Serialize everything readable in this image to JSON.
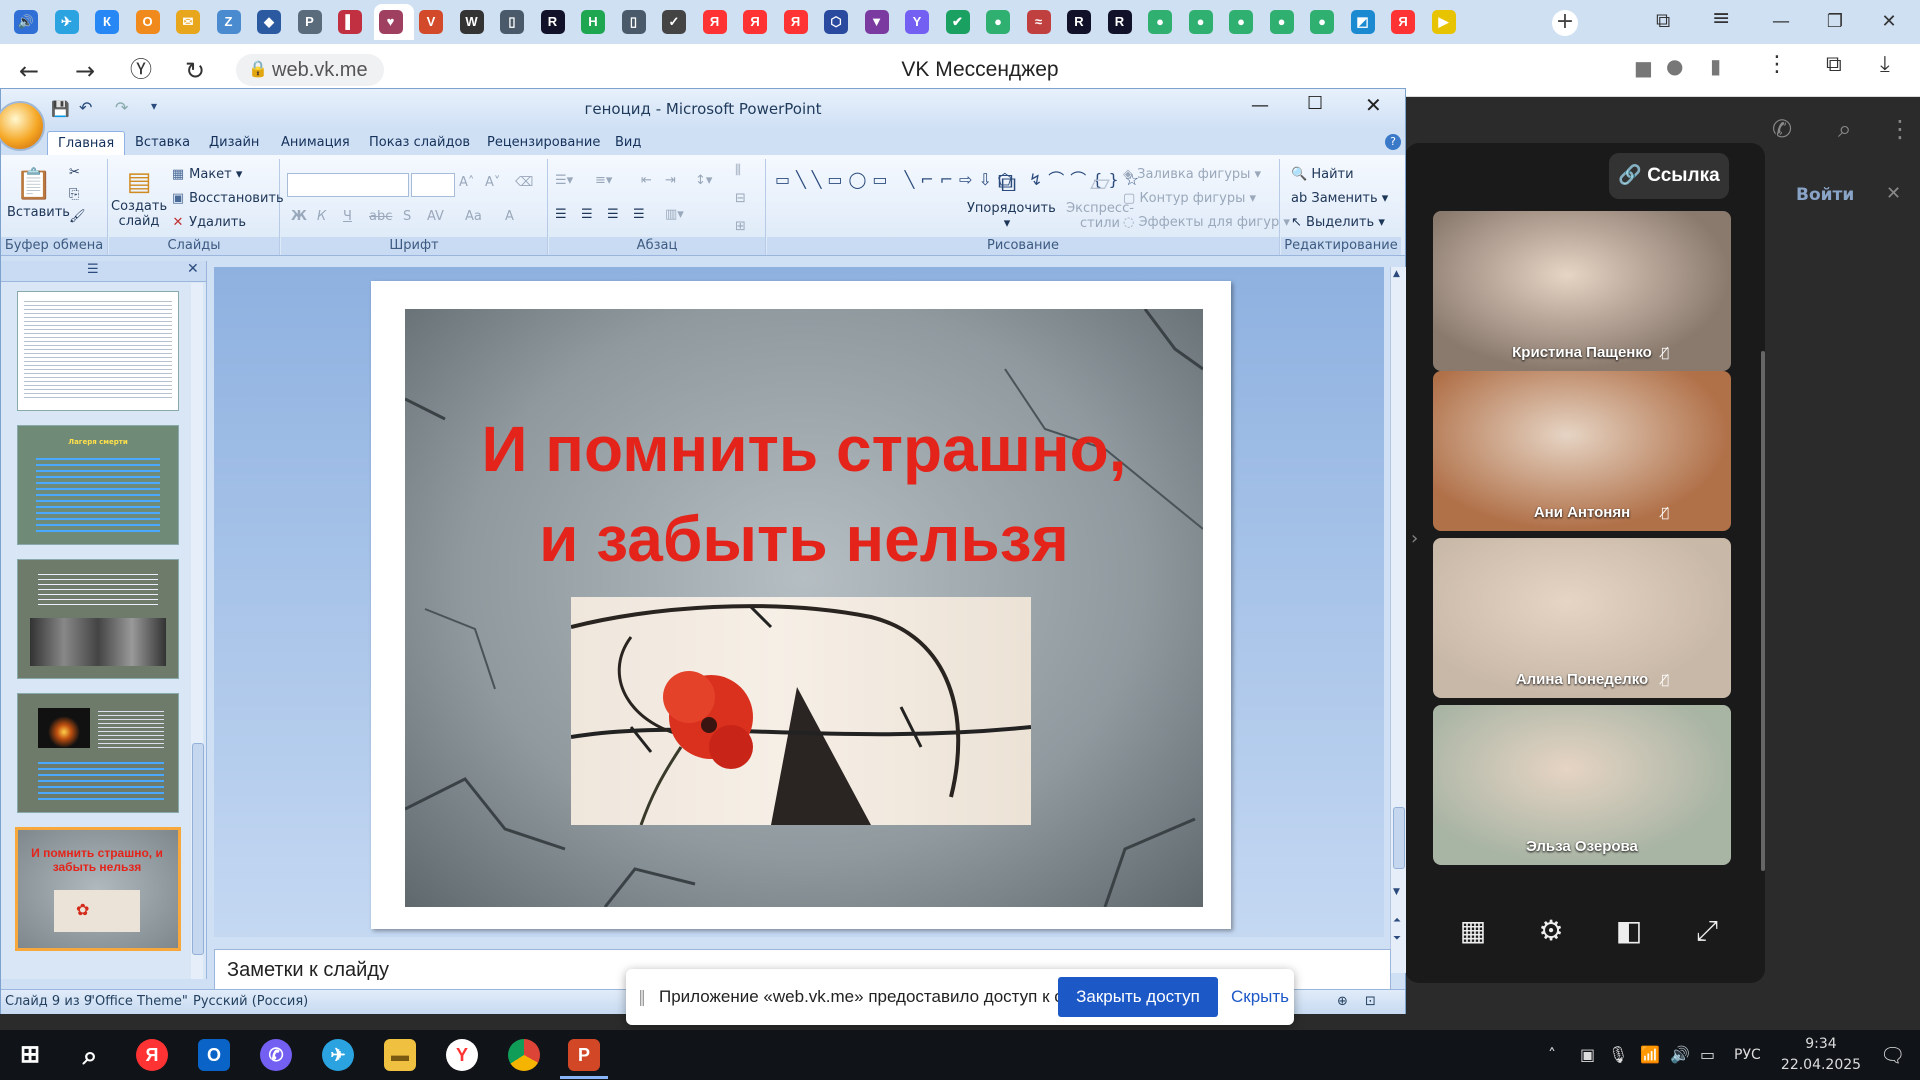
{
  "browser": {
    "tabs": [
      {
        "name": "volume-tab-icon",
        "glyph": "🔊",
        "color": "#2f6fd6"
      },
      {
        "name": "telegram-tab-icon",
        "glyph": "✈",
        "color": "#2aa3e0"
      },
      {
        "name": "vk-tab-icon",
        "glyph": "К",
        "color": "#2787f5"
      },
      {
        "name": "ok-tab-icon",
        "glyph": "О",
        "color": "#f08a1c"
      },
      {
        "name": "mail-tab-icon",
        "glyph": "✉",
        "color": "#e8a61c"
      },
      {
        "name": "tab-icon-6",
        "glyph": "Z",
        "color": "#4a8bd0"
      },
      {
        "name": "tab-icon-7",
        "glyph": "◆",
        "color": "#2c5aa0"
      },
      {
        "name": "tab-icon-8",
        "glyph": "P",
        "color": "#5a6b7c"
      },
      {
        "name": "tab-icon-9",
        "glyph": "▌",
        "color": "#c03040"
      },
      {
        "name": "tab-icon-10",
        "glyph": "♥",
        "color": "#a04060"
      },
      {
        "name": "tab-icon-11",
        "glyph": "V",
        "color": "#d24a2a"
      },
      {
        "name": "tab-icon-12",
        "glyph": "W",
        "color": "#333333"
      },
      {
        "name": "document-tab-icon",
        "glyph": "▯",
        "color": "#4a5a6a"
      },
      {
        "name": "rutube-tab-icon",
        "glyph": "R",
        "color": "#11122a"
      },
      {
        "name": "hd-tab-icon",
        "glyph": "H",
        "color": "#1ea650"
      },
      {
        "name": "document-tab-icon-2",
        "glyph": "▯",
        "color": "#4a5a6a"
      },
      {
        "name": "tab-icon-17",
        "glyph": "✓",
        "color": "#444444"
      },
      {
        "name": "yandex-tab-icon",
        "glyph": "Я",
        "color": "#f33"
      },
      {
        "name": "yandex-tab-icon-2",
        "glyph": "Я",
        "color": "#f33"
      },
      {
        "name": "yandex-tab-icon-3",
        "glyph": "Я",
        "color": "#f33"
      },
      {
        "name": "tab-icon-21",
        "glyph": "⬡",
        "color": "#2a4aa0"
      },
      {
        "name": "tab-icon-22",
        "glyph": "▼",
        "color": "#7b3aa0"
      },
      {
        "name": "viber-tab-icon",
        "glyph": "Y",
        "color": "#7360f2"
      },
      {
        "name": "check-tab-icon",
        "glyph": "✔",
        "color": "#1aa060"
      },
      {
        "name": "tab-icon-25",
        "glyph": "●",
        "color": "#30b070"
      },
      {
        "name": "tab-icon-26",
        "glyph": "≈",
        "color": "#c04040"
      },
      {
        "name": "rutube-tab-icon-2",
        "glyph": "R",
        "color": "#11122a"
      },
      {
        "name": "rutube-tab-icon-3",
        "glyph": "R",
        "color": "#11122a"
      },
      {
        "name": "tab-icon-29",
        "glyph": "●",
        "color": "#30b070"
      },
      {
        "name": "tab-icon-30",
        "glyph": "●",
        "color": "#30b070"
      },
      {
        "name": "tab-icon-31",
        "glyph": "●",
        "color": "#30b070"
      },
      {
        "name": "tab-icon-32",
        "glyph": "●",
        "color": "#30b070"
      },
      {
        "name": "tab-icon-33",
        "glyph": "●",
        "color": "#30b070"
      },
      {
        "name": "tab-icon-34",
        "glyph": "◩",
        "color": "#1c8ad0"
      },
      {
        "name": "yandex-tab-icon-4",
        "glyph": "Я",
        "color": "#f33"
      },
      {
        "name": "tab-icon-36",
        "glyph": "▶",
        "color": "#e8c300"
      }
    ],
    "url": "web.vk.me",
    "page_title": "VK Мессенджер"
  },
  "powerpoint": {
    "window_title": "геноцид - Microsoft PowerPoint",
    "ribbon_tabs": [
      "Главная",
      "Вставка",
      "Дизайн",
      "Анимация",
      "Показ слайдов",
      "Рецензирование",
      "Вид"
    ],
    "groups": {
      "clipboard": {
        "label": "Буфер обмена",
        "paste": "Вставить"
      },
      "slides": {
        "label": "Слайды",
        "create": "Создать слайд",
        "layout": "Макет",
        "reset": "Восстановить",
        "delete": "Удалить"
      },
      "font": {
        "label": "Шрифт"
      },
      "paragraph": {
        "label": "Абзац"
      },
      "drawing": {
        "label": "Рисование",
        "arrange": "Упорядочить",
        "quick_styles": "Экспресс-стили",
        "fill": "Заливка фигуры",
        "outline": "Контур фигуры",
        "effects": "Эффекты для фигур"
      },
      "editing": {
        "label": "Редактирование",
        "find": "Найти",
        "replace": "Заменить",
        "select": "Выделить"
      }
    },
    "thumbnails": [
      {
        "title": "",
        "text": ""
      },
      {
        "title": "Лагеря смерти",
        "text": ""
      },
      {
        "title": "",
        "text": ""
      },
      {
        "title": "",
        "text": ""
      },
      {
        "title": "И помнить страшно, и забыть нельзя",
        "text": ""
      }
    ],
    "slide": {
      "title_line1": "И помнить страшно,",
      "title_line2": "и забыть нельзя"
    },
    "notes_placeholder": "Заметки к слайду",
    "status": {
      "slide": "Слайд 9 из 9",
      "theme": "\"Office Theme\"",
      "language": "Русский (Россия)"
    }
  },
  "vk": {
    "link_label": "Ссылка",
    "login_label": "Войти",
    "participants": [
      {
        "name": "Кристина Пащенко",
        "muted": true,
        "bg": "#8a7a6e"
      },
      {
        "name": "Ани Антонян",
        "muted": true,
        "bg": "#b07048"
      },
      {
        "name": "Алина Понеделко",
        "muted": true,
        "bg": "#c8b8a8"
      },
      {
        "name": "Эльза Озерова",
        "muted": false,
        "bg": "#a8b4a4"
      }
    ]
  },
  "share_bar": {
    "message": "Приложение «web.vk.me» предоставило доступ к окну.",
    "stop_button": "Закрыть доступ",
    "hide_button": "Скрыть"
  },
  "taskbar": {
    "language": "РУС",
    "time": "9:34",
    "date": "22.04.2025"
  }
}
